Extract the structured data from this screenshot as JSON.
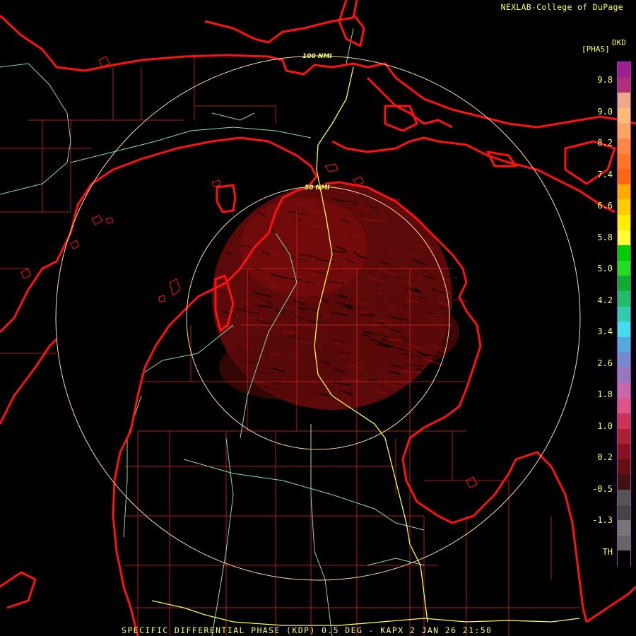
{
  "header": {
    "credit": "NEXLAB-College of DuPage"
  },
  "legend": {
    "title_top": "DKD",
    "title": "[PHAS]",
    "ticks": [
      "9.8",
      "9.0",
      "8.2",
      "7.4",
      "6.6",
      "5.8",
      "5.0",
      "4.2",
      "3.4",
      "2.6",
      "1.8",
      "1.0",
      "0.2",
      "-0.5",
      "-1.3",
      "TH"
    ],
    "colors": [
      "#9b1f8f",
      "#b0307a",
      "#eeaa88",
      "#ffbb77",
      "#ffa366",
      "#ff8844",
      "#ff7722",
      "#ff6611",
      "#ffaa00",
      "#ffcc00",
      "#ffee00",
      "#ffff33",
      "#00cc00",
      "#22dd22",
      "#11aa33",
      "#22bb66",
      "#33ccaa",
      "#44ddee",
      "#55aadd",
      "#7788cc",
      "#9977bb",
      "#cc66aa",
      "#dd5588",
      "#cc3355",
      "#aa2233",
      "#881122",
      "#661111",
      "#441111",
      "#555555",
      "#444444",
      "#777777",
      "#666666",
      "#000000"
    ]
  },
  "map": {
    "range_rings": [
      {
        "label": "100 NMI"
      },
      {
        "label": "50 NMI"
      }
    ],
    "colors": {
      "coast": "#ff1111",
      "county": "#cc2222",
      "highway": "#88ddaa",
      "interstate": "#ffff44",
      "ring": "#ffddaa",
      "echo": "#6b0a0a"
    }
  },
  "footer": {
    "caption": "SPECIFIC DIFFERENTIAL PHASE (KDP) 0.5 DEG - KAPX 2 JAN 26 21:50"
  }
}
